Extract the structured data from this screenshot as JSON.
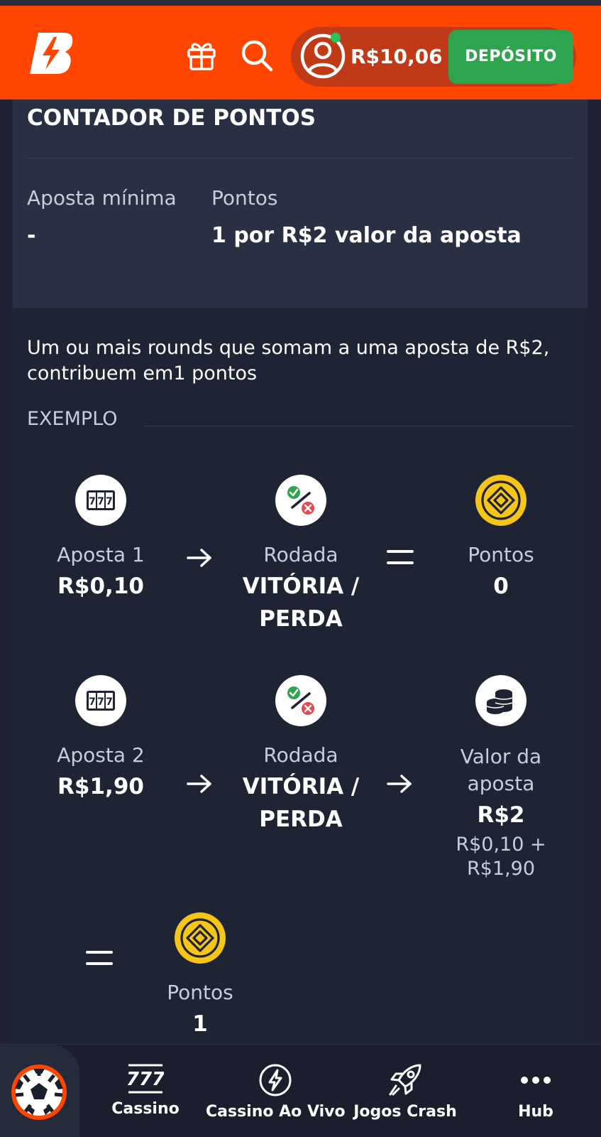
{
  "header": {
    "balance": "R$10,06",
    "deposit_label": "DEPÓSITO",
    "icons": [
      "brand-logo-icon",
      "gift-icon",
      "search-icon",
      "user-icon"
    ]
  },
  "points_card": {
    "title": "CONTADOR DE PONTOS",
    "min_bet_label": "Aposta mínima",
    "min_bet_value": "-",
    "points_label": "Pontos",
    "points_value": "1 por R$2 valor da aposta"
  },
  "explanation": {
    "description": "Um ou mais rounds que somam a uma aposta de R$2, contribuem em1 pontos",
    "example_label": "EXEMPLO",
    "row1": {
      "bet_label": "Aposta 1",
      "bet_value": "R$0,10",
      "round_label": "Rodada",
      "round_value_1": "VITÓRIA /",
      "round_value_2": "PERDA",
      "points_label": "Pontos",
      "points_value": "0"
    },
    "row2": {
      "bet_label": "Aposta 2",
      "bet_value": "R$1,90",
      "round_label": "Rodada",
      "round_value_1": "VITÓRIA /",
      "round_value_2": "PERDA",
      "total_label_1": "Valor da",
      "total_label_2": "aposta",
      "total_value": "R$2",
      "total_breakdown_1": "R$0,10 +",
      "total_breakdown_2": "R$1,90"
    },
    "result": {
      "points_label": "Pontos",
      "points_value": "1"
    }
  },
  "bottom_nav": {
    "items": [
      {
        "label": "Cassino",
        "icon": "slots-777-icon"
      },
      {
        "label": "Cassino Ao Vivo",
        "icon": "lightning-icon"
      },
      {
        "label": "Jogos Crash",
        "icon": "rocket-icon"
      },
      {
        "label": "Hub",
        "icon": "more-dots-icon"
      }
    ]
  },
  "colors": {
    "brand": "#ff4500",
    "deposit": "#2ea44f",
    "coin": "#f5c518",
    "background": "#1e2232"
  }
}
